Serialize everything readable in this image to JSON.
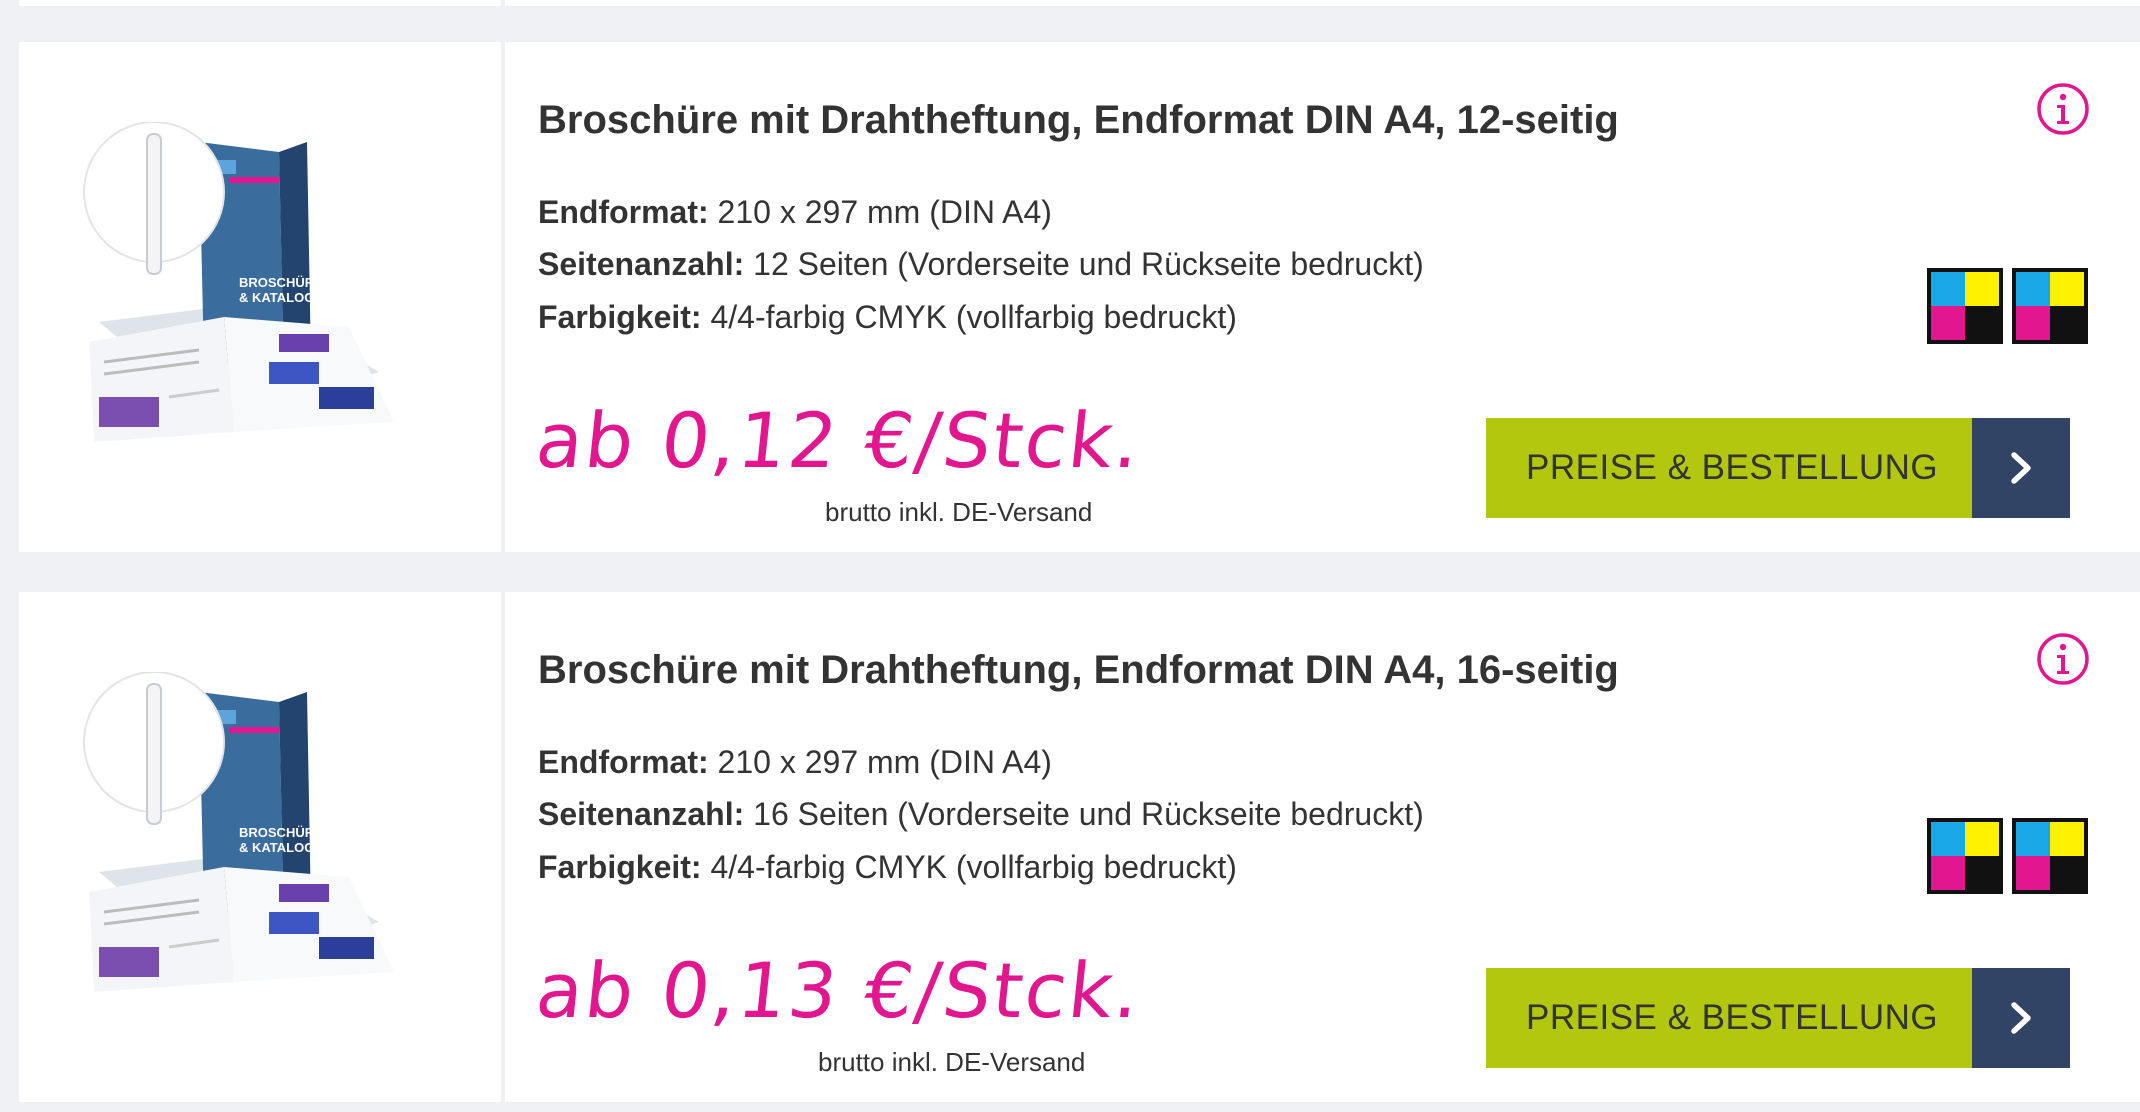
{
  "products": [
    {
      "title": "Broschüre mit Drahtheftung, Endformat DIN A4, 12-seitig",
      "specs": [
        {
          "label": "Endformat:",
          "value": "210 x 297 mm (DIN A4)"
        },
        {
          "label": "Seitenanzahl:",
          "value": "12 Seiten (Vorderseite und Rückseite bedruckt)"
        },
        {
          "label": "Farbigkeit:",
          "value": "4/4-farbig CMYK (vollfarbig bedruckt)"
        }
      ],
      "price": "ab 0,12 €/Stck.",
      "price_note": "brutto inkl. DE-Versand",
      "button_label": "PREISE & BESTELLUNG",
      "image_text": [
        "BROSCHÜREN",
        "& KATALOGE"
      ]
    },
    {
      "title": "Broschüre mit Drahtheftung, Endformat DIN A4, 16-seitig",
      "specs": [
        {
          "label": "Endformat:",
          "value": "210 x 297 mm (DIN A4)"
        },
        {
          "label": "Seitenanzahl:",
          "value": "16 Seiten (Vorderseite und Rückseite bedruckt)"
        },
        {
          "label": "Farbigkeit:",
          "value": "4/4-farbig CMYK (vollfarbig bedruckt)"
        }
      ],
      "price": "ab 0,13 €/Stck.",
      "price_note": "brutto inkl. DE-Versand",
      "button_label": "PREISE & BESTELLUNG",
      "image_text": [
        "BROSCHÜREN",
        "& KATALOGE"
      ]
    }
  ],
  "icons": {
    "info": "info-circle-icon",
    "cmyk": "cmyk-color-icon",
    "arrow": "chevron-right-icon"
  },
  "colors": {
    "accent_pink": "#e2168e",
    "button_green": "#b2c70e",
    "button_navy": "#314466",
    "background": "#eff1f4"
  }
}
